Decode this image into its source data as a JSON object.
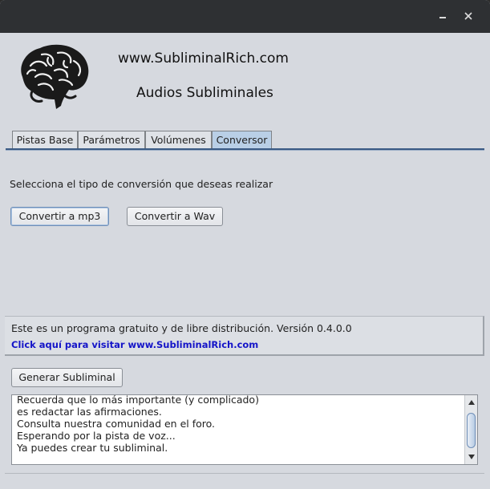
{
  "window": {
    "minimize_icon": "minimize-icon",
    "close_icon": "close-icon"
  },
  "header": {
    "logo_icon": "brain-icon",
    "site": "www.SubliminalRich.com",
    "title": "Audios Subliminales"
  },
  "tabs": [
    {
      "label": "Pistas Base"
    },
    {
      "label": "Parámetros"
    },
    {
      "label": "Volúmenes"
    },
    {
      "label": "Conversor",
      "selected": true
    }
  ],
  "converter": {
    "prompt": "Selecciona el tipo de conversión que deseas realizar",
    "mp3_label": "Convertir a mp3",
    "wav_label": "Convertir a Wav"
  },
  "info": {
    "text": "Este es un programa gratuito y de libre distribución. Versión 0.4.0.0",
    "link": "Click aquí para visitar www.SubliminalRich.com",
    "link_color": "#1414c8"
  },
  "generate_label": "Generar Subliminal",
  "log": {
    "lines": [
      "Recuerda que lo más importante (y complicado)",
      "es redactar las afirmaciones.",
      "Consulta nuestra comunidad en el foro.",
      "Esperando por la pista de voz...",
      "Ya puedes crear tu subliminal."
    ]
  },
  "colors": {
    "titlebar": "#2e3033",
    "background": "#d6d9df",
    "active_tab": "#b9cfe6",
    "tab_line": "#3a5a84"
  }
}
